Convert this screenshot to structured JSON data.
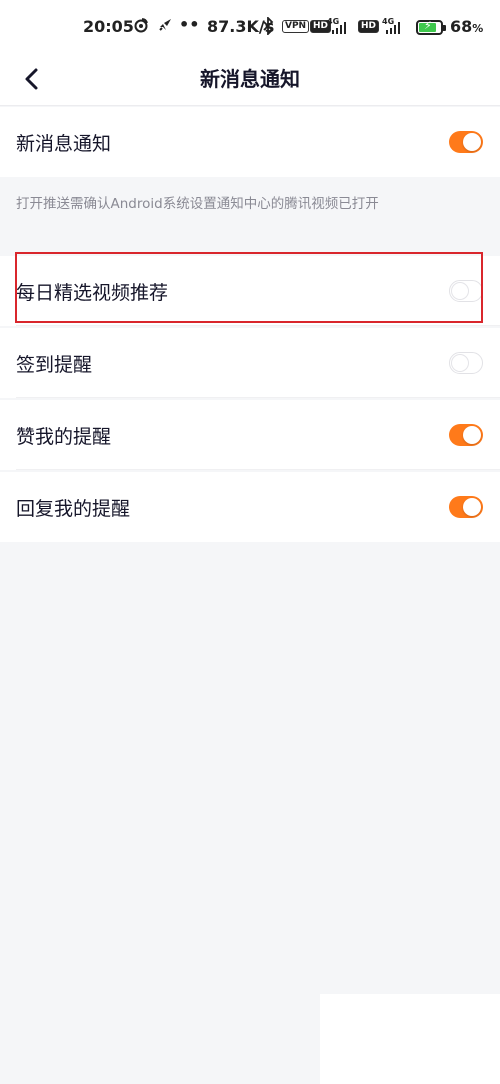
{
  "status_bar": {
    "time": "20:05",
    "speed": "87.3K/s",
    "vpn_label": "VPN",
    "hd1": "HD",
    "net1": "4G",
    "hd2": "HD",
    "net2": "4G",
    "battery_pct": "68",
    "pct_sign": "%",
    "icons": [
      "weibo-icon",
      "rocket-icon",
      "more-dots-icon",
      "bluetooth-icon",
      "signal-icon",
      "battery-charging-icon"
    ]
  },
  "nav": {
    "back_icon": "back-arrow-icon",
    "title": "新消息通知"
  },
  "settings": {
    "main_toggle": {
      "label": "新消息通知",
      "state": "on"
    },
    "hint": "打开推送需确认Android系统设置通知中心的腾讯视频已打开",
    "items": [
      {
        "label": "每日精选视频推荐",
        "state": "off",
        "highlighted": true
      },
      {
        "label": "签到提醒",
        "state": "off"
      },
      {
        "label": "赞我的提醒",
        "state": "on"
      },
      {
        "label": "回复我的提醒",
        "state": "on"
      }
    ]
  },
  "colors": {
    "toggle_on": "#ff7a1a",
    "highlight": "#d9262c",
    "background": "#f5f6f8"
  }
}
